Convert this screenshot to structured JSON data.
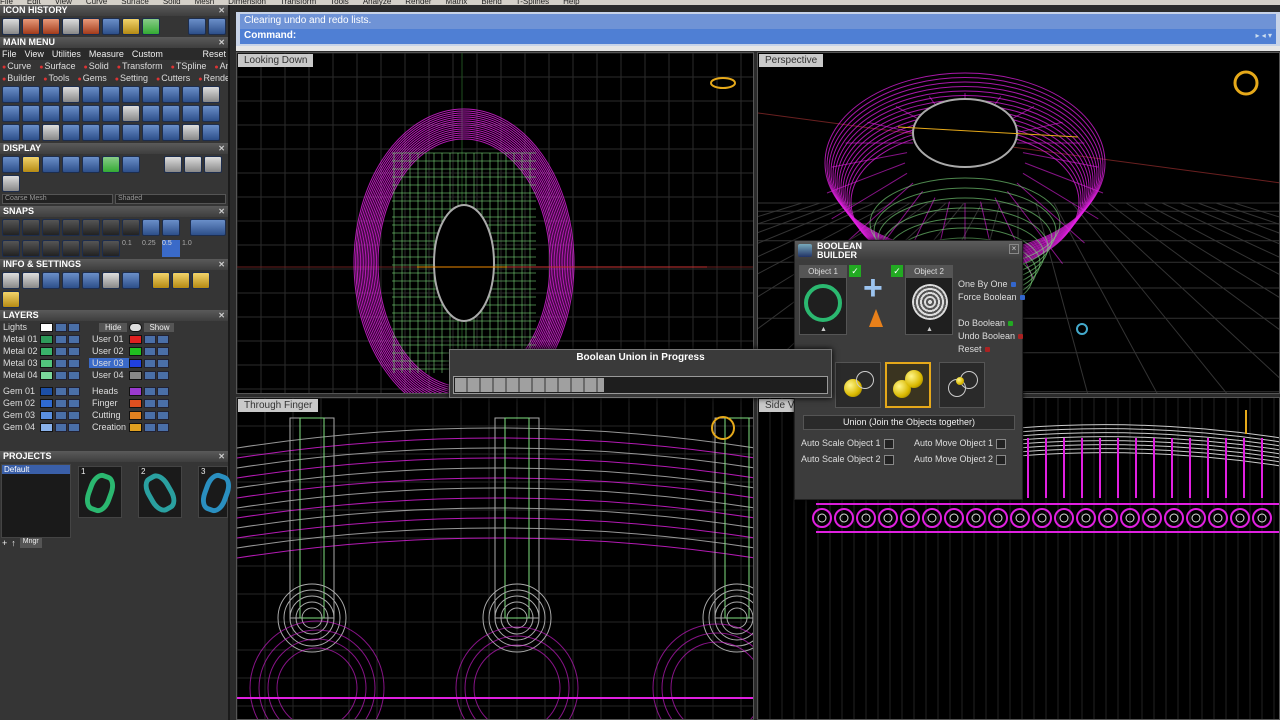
{
  "menubar": [
    "File",
    "Edit",
    "View",
    "Curve",
    "Surface",
    "Solid",
    "Mesh",
    "Dimension",
    "Transform",
    "Tools",
    "Analyze",
    "Render",
    "Matrix",
    "Blend",
    "T-Splines",
    "Help"
  ],
  "command": {
    "history": "Clearing undo and redo lists.",
    "prompt": "Command:"
  },
  "left": {
    "icon_history": "ICON HISTORY",
    "main_menu": "MAIN MENU",
    "menu_tabs": [
      "File",
      "View",
      "Utilities",
      "Measure",
      "Custom"
    ],
    "menu_reset": "Reset",
    "menu_row1": [
      "Curve",
      "Surface",
      "Solid",
      "Transform",
      "TSpline",
      "Art"
    ],
    "menu_row2": [
      "Builder",
      "Tools",
      "Gems",
      "Setting",
      "Cutters",
      "Render"
    ],
    "display": "DISPLAY",
    "display_mode_a": "Coarse Mesh",
    "display_mode_b": "Shaded",
    "snaps": "SNAPS",
    "snap_values": [
      "0.1",
      "0.25",
      "0.5",
      "1.0"
    ],
    "info_settings": "INFO & SETTINGS",
    "layers": "LAYERS",
    "lights": "Lights",
    "hide": "Hide",
    "show": "Show",
    "layers_left": [
      {
        "name": "Metal 01",
        "color": "#2e9a5a"
      },
      {
        "name": "Metal 02",
        "color": "#39b36a"
      },
      {
        "name": "Metal 03",
        "color": "#52c47c"
      },
      {
        "name": "Metal 04",
        "color": "#7ad69a"
      },
      {
        "name": "Gem 01",
        "color": "#1c4fa6"
      },
      {
        "name": "Gem 02",
        "color": "#2f6ad1"
      },
      {
        "name": "Gem 03",
        "color": "#5a8fe0"
      },
      {
        "name": "Gem 04",
        "color": "#8ab2ea"
      }
    ],
    "layers_right": [
      {
        "name": "User 01",
        "color": "#e02020"
      },
      {
        "name": "User 02",
        "color": "#20c020"
      },
      {
        "name": "User 03",
        "color": "#2040e0"
      },
      {
        "name": "User 04",
        "color": "#888888"
      },
      {
        "name": "Heads",
        "color": "#9a3ad0"
      },
      {
        "name": "Finger",
        "color": "#e05020"
      },
      {
        "name": "Cutting",
        "color": "#e08020"
      },
      {
        "name": "Creation",
        "color": "#e0a020"
      }
    ],
    "projects": "PROJECTS",
    "project_default": "Default",
    "project_numbers": [
      "1",
      "2",
      "3"
    ],
    "mngr": "Mngr"
  },
  "viewports": {
    "top_left": "Looking Down",
    "top_right": "Perspective",
    "bottom_left": "Through Finger",
    "bottom_right": "Side V"
  },
  "boolean": {
    "title": "BOOLEAN BUILDER",
    "object1": "Object 1",
    "object2": "Object 2",
    "one_by_one": "One By One",
    "force_boolean": "Force Boolean",
    "do_boolean": "Do Boolean",
    "undo_boolean": "Undo Boolean",
    "reset": "Reset",
    "description": "Union (Join the Objects together)",
    "auto_scale_1": "Auto Scale Object 1",
    "auto_scale_2": "Auto Scale Object 2",
    "auto_move_1": "Auto Move Object 1",
    "auto_move_2": "Auto Move Object 2"
  },
  "progress": {
    "title": "Boolean Union in Progress",
    "fraction": 0.4
  },
  "colors": {
    "wire_magenta": "#e020e0",
    "wire_green": "#80e080",
    "command_blue": "#4f7fd4",
    "accent_gold": "#e6a91a"
  }
}
